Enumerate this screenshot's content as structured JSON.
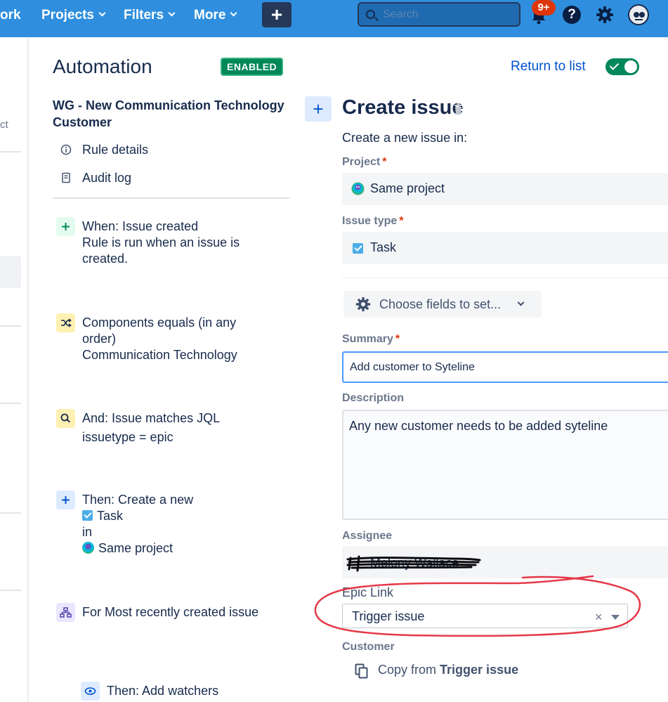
{
  "nav": {
    "partial_item": "ork",
    "items": [
      {
        "label": "Projects"
      },
      {
        "label": "Filters"
      },
      {
        "label": "More"
      }
    ],
    "create_label": "+",
    "search_placeholder": "Search",
    "notifications_badge": "9+",
    "help_label": "?"
  },
  "left_strip": {
    "partial_text": "ct"
  },
  "sidebar": {
    "title": "Automation",
    "status_badge": "ENABLED",
    "rule_name": "WG - New Communication Technology Customer",
    "links": [
      {
        "label": "Rule details",
        "icon": "info-icon"
      },
      {
        "label": "Audit log",
        "icon": "document-icon"
      }
    ],
    "steps": [
      {
        "icon": "plus-icon",
        "title": "When: Issue created",
        "detail": "Rule is run when an issue is created."
      },
      {
        "icon": "shuffle-icon",
        "title": "Components equals (in any order)",
        "detail": "Communication Technology"
      },
      {
        "icon": "search-icon",
        "title": "And: Issue matches JQL",
        "detail": "issuetype = epic"
      },
      {
        "icon": "plus-icon",
        "title": "Then: Create a new",
        "issue_type": "Task",
        "connector": "in",
        "project": "Same project"
      },
      {
        "icon": "hierarchy-icon",
        "title": "For Most recently created issue"
      },
      {
        "icon": "eye-icon",
        "title": "Then: Add watchers"
      }
    ]
  },
  "header": {
    "return_link": "Return to list",
    "toggle_on": true
  },
  "action": {
    "add_label": "+",
    "title": "Create issue",
    "subtitle": "Create a new issue in:",
    "project": {
      "label": "Project",
      "required": "*",
      "value": "Same project"
    },
    "issue_type": {
      "label": "Issue type",
      "required": "*",
      "value": "Task"
    },
    "choose_fields": "Choose fields to set...",
    "summary": {
      "label": "Summary",
      "required": "*",
      "value": "Add customer to Syteline"
    },
    "description": {
      "label": "Description",
      "value": "Any new customer needs to be added syteline"
    },
    "assignee": {
      "label": "Assignee",
      "value": "Melony Wallace"
    },
    "epic_link": {
      "label": "Epic Link",
      "value": "Trigger issue",
      "clear": "×"
    },
    "customer": {
      "label": "Customer",
      "copy_prefix": "Copy from",
      "copy_source": "Trigger issue"
    }
  },
  "colors": {
    "nav_bg": "#2f8fde",
    "accent": "#0052cc",
    "enabled_green": "#00875a",
    "required_red": "#de350b",
    "annotation_red": "#e53948"
  }
}
